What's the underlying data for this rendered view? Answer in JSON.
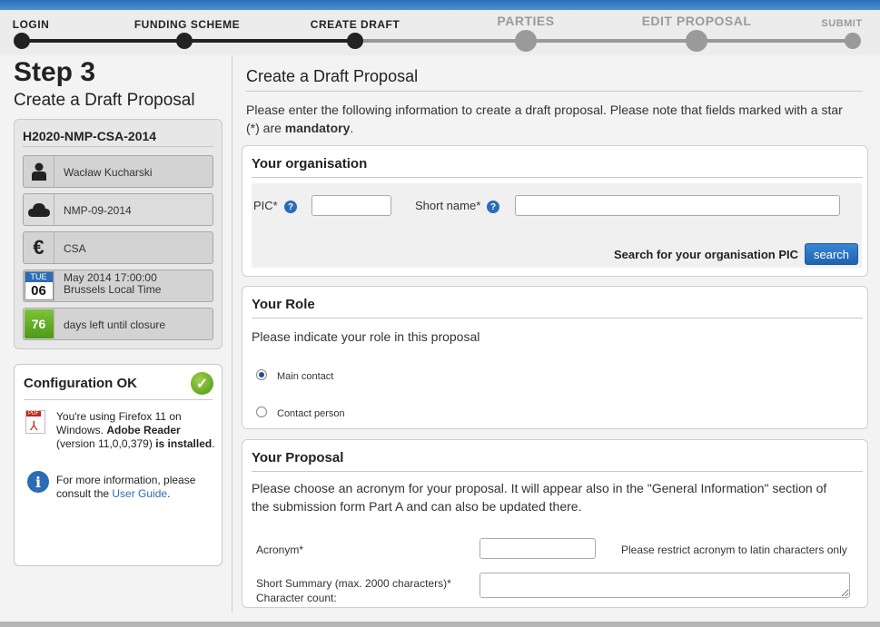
{
  "wizard": {
    "steps": [
      {
        "label": "LOGIN",
        "state": "done"
      },
      {
        "label": "FUNDING SCHEME",
        "state": "done"
      },
      {
        "label": "CREATE DRAFT",
        "state": "current"
      },
      {
        "label": "PARTIES",
        "state": "todo"
      },
      {
        "label": "EDIT PROPOSAL",
        "state": "todo"
      },
      {
        "label": "SUBMIT",
        "state": "todo"
      }
    ]
  },
  "sidebar": {
    "step_number": "Step 3",
    "step_title": "Create a Draft Proposal",
    "call_id": "H2020-NMP-CSA-2014",
    "user_name": "Wacław Kucharski",
    "topic": "NMP-09-2014",
    "action_type": "CSA",
    "deadline": {
      "weekday": "TUE",
      "day": "06",
      "datetime": "May 2014 17:00:00",
      "timezone": "Brussels Local Time"
    },
    "days_left": "76",
    "days_left_label": "days left until closure"
  },
  "config": {
    "title": "Configuration OK",
    "browser_text_1": "You're using Firefox 11 on Windows.",
    "reader_name": "Adobe Reader",
    "reader_version": "(version 11,0,0,379)",
    "reader_is": "is",
    "reader_installed": "installed",
    "period": ".",
    "more_info": "For more information, please consult the",
    "user_guide_link": "User Guide",
    "icons": {
      "pdf": "pdf-file-icon",
      "info": "info-icon",
      "check": "check-icon"
    }
  },
  "main": {
    "title": "Create a Draft Proposal",
    "intro_text": "Please enter the following information to create a draft proposal. Please note that fields marked with a star (*) are",
    "intro_bold": "mandatory",
    "intro_end": "."
  },
  "organisation": {
    "title": "Your organisation",
    "pic_label": "PIC*",
    "pic_value": "",
    "short_name_label": "Short name*",
    "short_name_value": "",
    "search_label": "Search for your organisation PIC",
    "search_button": "search"
  },
  "role": {
    "title": "Your Role",
    "prompt": "Please indicate your role in this proposal",
    "options": [
      {
        "label": "Main contact",
        "selected": true
      },
      {
        "label": "Contact person",
        "selected": false
      }
    ]
  },
  "proposal": {
    "title": "Your Proposal",
    "prompt": "Please choose an acronym for your proposal. It will appear also in the \"General Information\" section of the submission form Part A and can also be updated there.",
    "acronym_label": "Acronym*",
    "acronym_value": "",
    "acronym_hint": "Please restrict acronym to latin characters only",
    "summary_label": "Short Summary (max. 2000 characters)*",
    "char_count_label": "Character count:",
    "summary_value": ""
  },
  "colors": {
    "accent": "#2b6cb6",
    "success": "#5aa51e",
    "top_bar": "#3a7cc4"
  }
}
